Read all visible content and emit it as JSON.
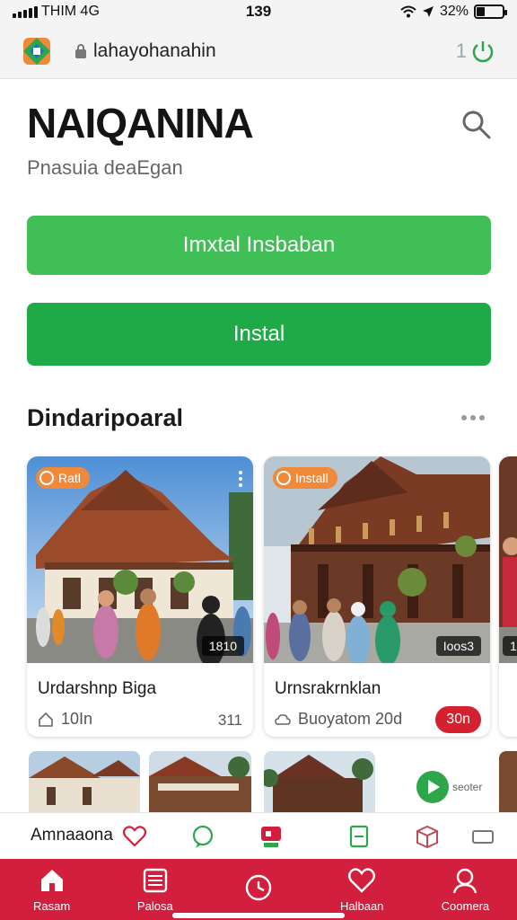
{
  "status_bar": {
    "carrier": "THIM 4G",
    "time": "139",
    "battery": "32%",
    "battery_level": 0.32
  },
  "browser": {
    "url": "lahayohanahin",
    "tab_count": "1"
  },
  "header": {
    "title": "NAIQANINA",
    "subtitle": "Pnasuia deaEgan"
  },
  "actions": {
    "secondary_label": "Imxtal Insbaban",
    "primary_label": "Instal"
  },
  "section": {
    "title": "Dindaripoaral"
  },
  "cards": [
    {
      "badge": "Ratl",
      "counter": "1810",
      "title": "Urdarshnp Biga",
      "meta": "10In",
      "meta_right": "311"
    },
    {
      "badge": "Install",
      "counter": "Ioos3",
      "title": "Urnsrakrnklan",
      "meta": "Buoyatom 20d",
      "action": "30n"
    },
    {
      "counter": "1"
    }
  ],
  "fab": {
    "label": "seoter"
  },
  "strip": {
    "label": "Amnaaona"
  },
  "bottom_nav": [
    {
      "label": "Rasam",
      "icon": "home-icon"
    },
    {
      "label": "Palosa",
      "icon": "list-icon"
    },
    {
      "label": "",
      "icon": "clock-icon"
    },
    {
      "label": "Halbaan",
      "icon": "heart-icon"
    },
    {
      "label": "Coomera",
      "icon": "profile-icon"
    }
  ],
  "colors": {
    "primary_green": "#1faa48",
    "secondary_green": "#3fbf55",
    "nav_red": "#d11f3d",
    "badge_orange": "#f08a3a"
  }
}
